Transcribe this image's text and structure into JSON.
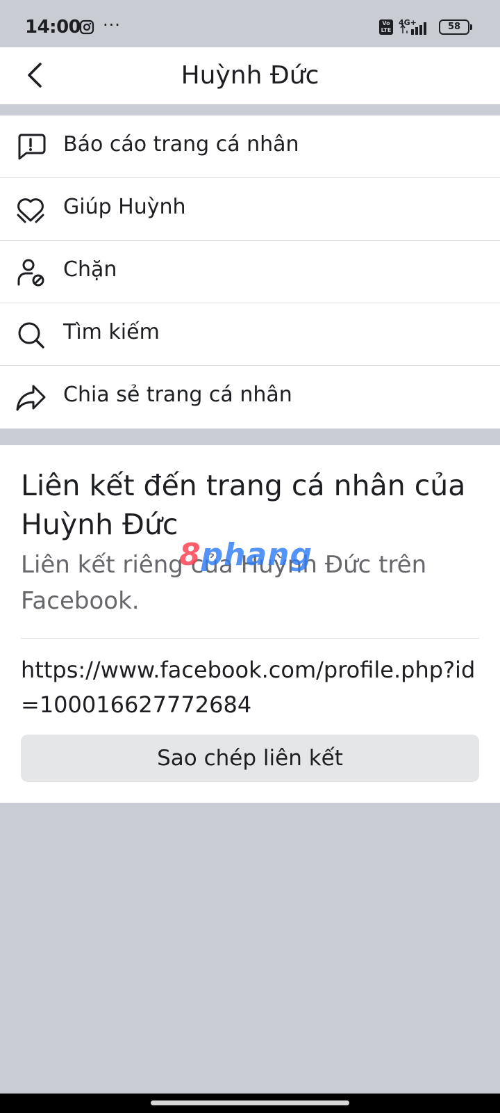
{
  "status_bar": {
    "time": "14:00",
    "more": "···",
    "volte_label": "Vo LTE",
    "network_label": "4G+",
    "battery_level": "58"
  },
  "header": {
    "title": "Huỳnh Đức"
  },
  "menu": {
    "items": [
      {
        "label": "Báo cáo trang cá nhân",
        "icon": "report-icon"
      },
      {
        "label": "Giúp Huỳnh",
        "icon": "heart-hands-icon"
      },
      {
        "label": "Chặn",
        "icon": "block-user-icon"
      },
      {
        "label": "Tìm kiếm",
        "icon": "search-icon"
      },
      {
        "label": "Chia sẻ trang cá nhân",
        "icon": "share-icon"
      }
    ]
  },
  "profile_link": {
    "title": "Liên kết đến trang cá nhân của Huỳnh Đức",
    "subtitle": "Liên kết riêng của Huỳnh Đức trên Facebook.",
    "url": "https://www.facebook.com/profile.php?id=100016627772684",
    "copy_button_label": "Sao chép liên kết"
  },
  "watermark": {
    "part_a": "8",
    "part_b": "phang"
  },
  "colors": {
    "background": "#c9ccd3",
    "card": "#ffffff",
    "text": "#1c1e21",
    "secondary_text": "#65676b",
    "button": "#e4e6e8"
  }
}
